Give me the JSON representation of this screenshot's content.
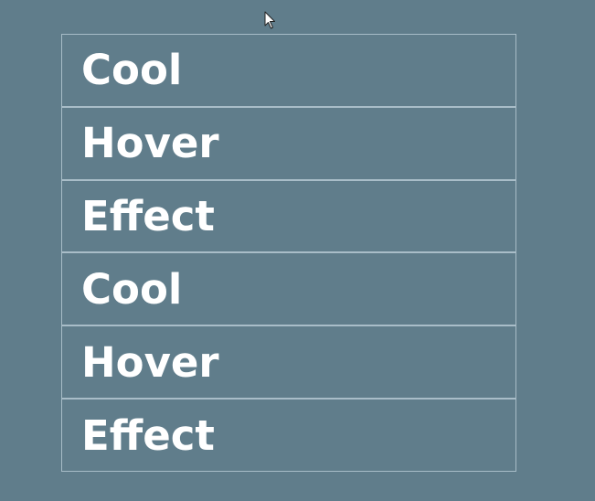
{
  "menu": {
    "items": [
      {
        "label": "Cool"
      },
      {
        "label": "Hover"
      },
      {
        "label": "Effect"
      },
      {
        "label": "Cool"
      },
      {
        "label": "Hover"
      },
      {
        "label": "Effect"
      }
    ]
  },
  "colors": {
    "background": "#607d8b",
    "text": "#ffffff",
    "border": "#a9bdc8"
  },
  "icons": {
    "cursor": "mouse-pointer-icon"
  }
}
